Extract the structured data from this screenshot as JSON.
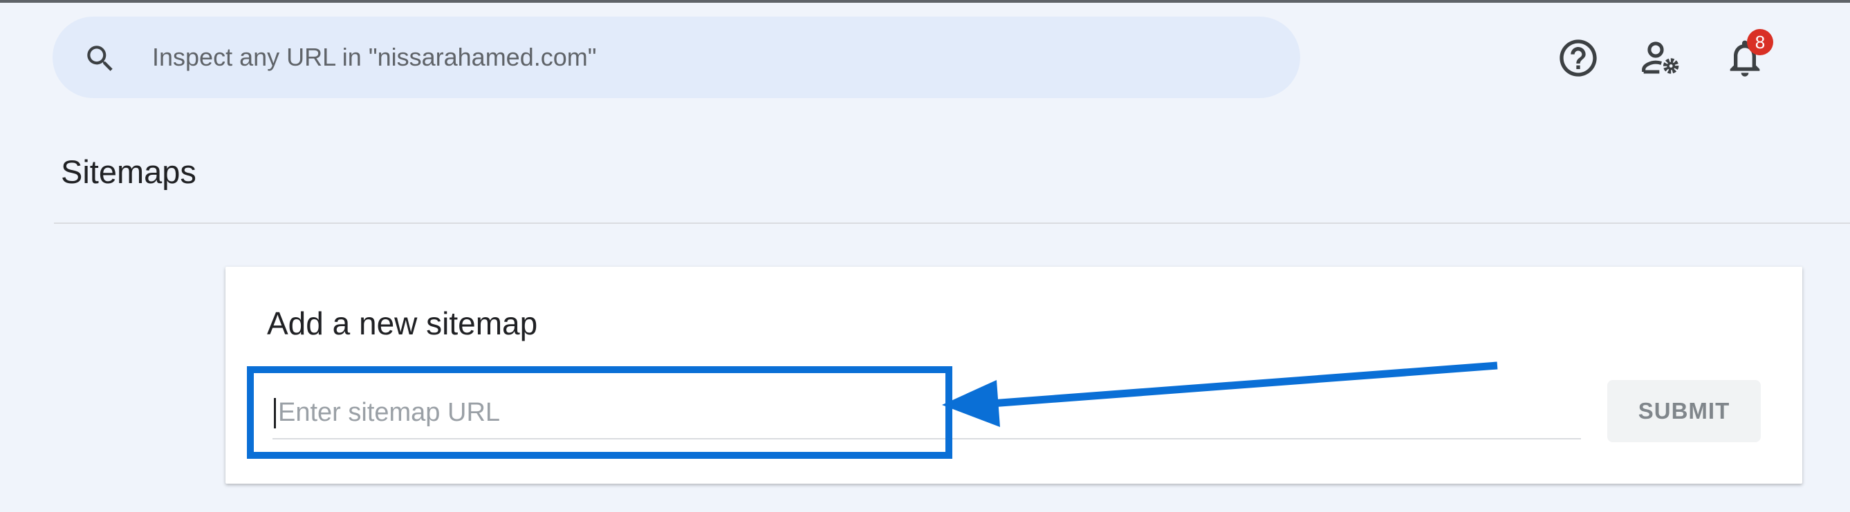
{
  "header": {
    "search_placeholder": "Inspect any URL in \"nissarahamed.com\"",
    "notification_count": "8",
    "icons": [
      "search-icon",
      "help-icon",
      "admin-settings-icon",
      "notifications-bell-icon"
    ]
  },
  "page": {
    "title": "Sitemaps"
  },
  "sitemap_card": {
    "title": "Add a new sitemap",
    "input_placeholder": "Enter sitemap URL",
    "input_value": "",
    "submit_label": "SUBMIT"
  },
  "colors": {
    "page_background": "#f0f4fb",
    "search_background": "#e2ebfa",
    "annotation_blue": "#0a6fd6",
    "badge_red": "#d93025",
    "submit_disabled_text": "#80868b"
  }
}
